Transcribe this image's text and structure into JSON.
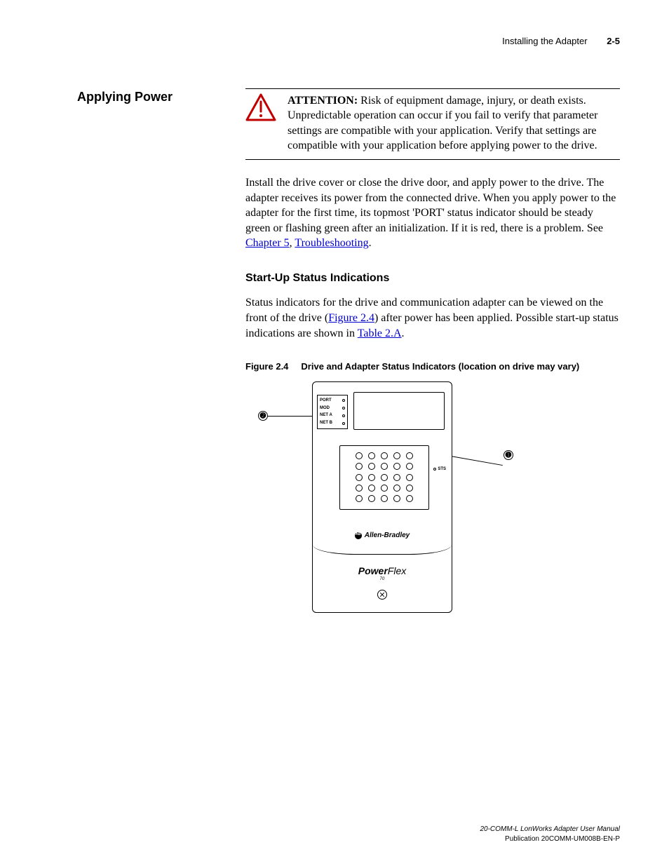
{
  "header": {
    "title": "Installing the Adapter",
    "page": "2-5"
  },
  "section_heading": "Applying Power",
  "attention": {
    "lead": "ATTENTION:",
    "text": "Risk of equipment damage, injury, or death exists. Unpredictable operation can occur if you fail to verify that parameter settings are compatible with your application. Verify that settings are compatible with your application before applying power to the drive."
  },
  "para1": {
    "pre": "Install the drive cover or close the drive door, and apply power to the drive. The adapter receives its power from the connected drive. When you apply power to the adapter for the first time, its topmost 'PORT' status indicator should be steady green or flashing green after an initialization. If it is red, there is a problem. See ",
    "link1": "Chapter 5",
    "mid": ", ",
    "link2": "Troubleshooting",
    "post": "."
  },
  "sub_heading": "Start-Up Status Indications",
  "para2": {
    "pre": "Status indicators for the drive and communication adapter can be viewed on the front of the drive (",
    "link1": "Figure 2.4",
    "mid": ") after power has been applied. Possible start-up status indications are shown in ",
    "link2": "Table 2.A",
    "post": "."
  },
  "figure": {
    "label": "Figure 2.4",
    "caption": "Drive and Adapter Status Indicators (location on drive may vary)",
    "leds": {
      "l1": "PORT",
      "l2": "MOD",
      "l3": "NET A",
      "l4": "NET B"
    },
    "sts": "STS",
    "brand": "Allen-Bradley",
    "product_pre": "Power",
    "product_post": "Flex",
    "product_sub": "70",
    "callout1": "➊",
    "callout2": "➋"
  },
  "footer": {
    "line1": "20-COMM-L LonWorks Adapter User Manual",
    "line2": "Publication 20COMM-UM008B-EN-P"
  }
}
